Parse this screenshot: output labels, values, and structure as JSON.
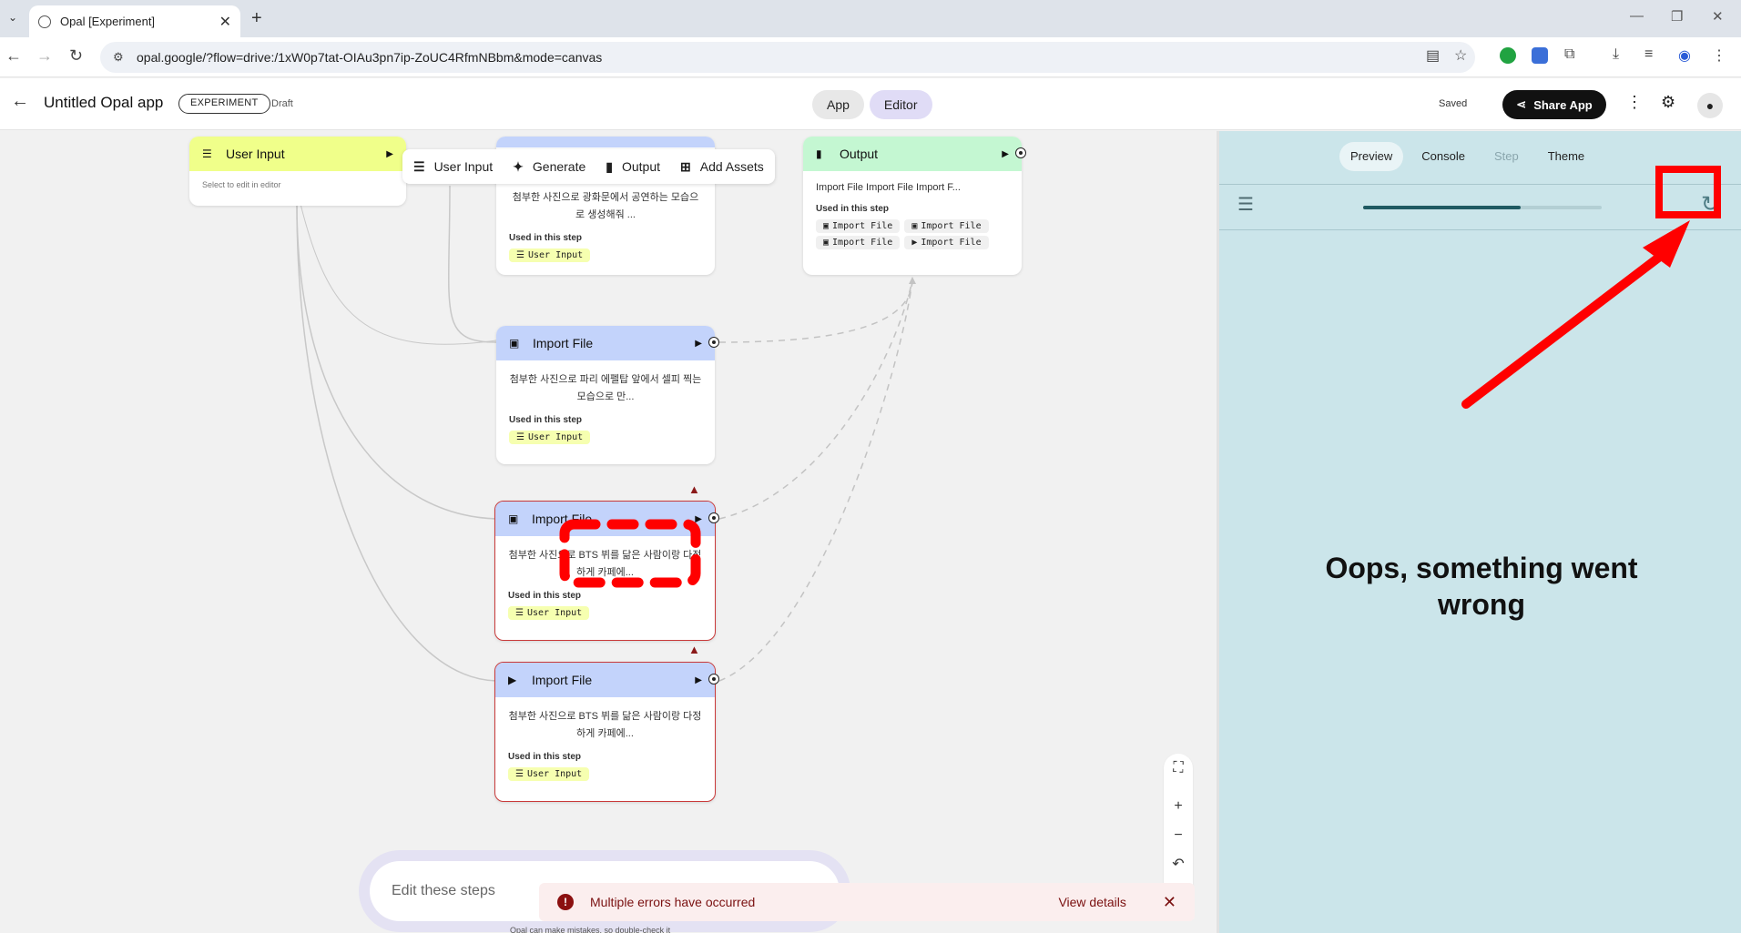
{
  "browser": {
    "tab_title": "Opal [Experiment]",
    "url": "opal.google/?flow=drive:/1xW0p7tat-OIAu3pn7ip-ZoUC4RfmNBbm&mode=canvas"
  },
  "header": {
    "title": "Untitled Opal app",
    "badge": "EXPERIMENT",
    "status": "Draft",
    "mode_app": "App",
    "mode_editor": "Editor",
    "saved": "Saved",
    "share": "Share App"
  },
  "toolbar": {
    "user_input": "User Input",
    "generate": "Generate",
    "output": "Output",
    "add_assets": "Add Assets"
  },
  "nodes": {
    "user_input": {
      "title": "User Input",
      "hint": "Select to edit in editor"
    },
    "gen1": {
      "desc": "첨부한 사진으로 광화문에서 공연하는 모습으로 생성해줘 ...",
      "used": "Used in this step",
      "chip": "User Input"
    },
    "import1": {
      "title": "Import File",
      "desc": "첨부한 사진으로 파리 에펠탑 앞에서 셀피 찍는 모습으로 만...",
      "used": "Used in this step",
      "chip": "User Input"
    },
    "import2": {
      "title": "Import File",
      "desc": "첨부한 사진으로 BTS 뷔를 닮은 사람이랑 다정하게 카페에...",
      "used": "Used in this step",
      "chip": "User Input"
    },
    "import3": {
      "title": "Import File",
      "desc": "첨부한 사진으로 BTS 뷔를 닮은 사람이랑 다정하게 카페에...",
      "used": "Used in this step",
      "chip": "User Input"
    },
    "output": {
      "title": "Output",
      "desc": "Import File Import File Import F...",
      "used": "Used in this step",
      "chips": [
        "Import File",
        "Import File",
        "Import File",
        "Import File"
      ]
    }
  },
  "prompt": {
    "placeholder": "Edit these steps",
    "disclaimer": "Opal can make mistakes, so double-check it"
  },
  "toast": {
    "message": "Multiple errors have occurred",
    "action": "View details"
  },
  "preview": {
    "tabs": [
      "Preview",
      "Console",
      "Step",
      "Theme"
    ],
    "progress": 0.66,
    "error_title": "Oops, something went wrong"
  },
  "colors": {
    "user_input_head": "#f0ff8a",
    "step_head": "#c3d3fb",
    "output_head": "#c4f7d2",
    "preview_bg": "#cbe5ea",
    "error": "#c93a3a",
    "annotation": "#ff0000"
  }
}
